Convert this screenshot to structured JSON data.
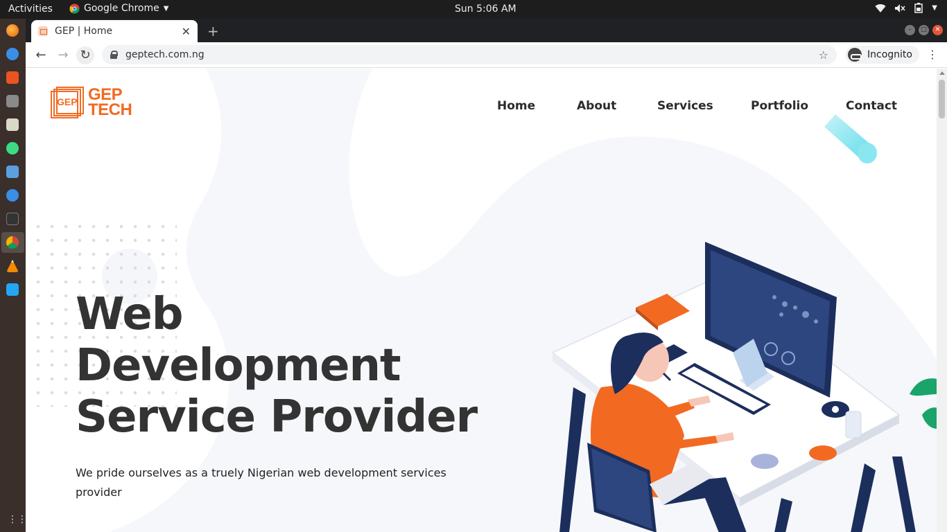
{
  "system": {
    "activities": "Activities",
    "app_name": "Google Chrome",
    "clock": "Sun  5:06 AM"
  },
  "browser": {
    "tab_title": "GEP | Home",
    "url": "geptech.com.ng",
    "incognito_label": "Incognito"
  },
  "site": {
    "logo_mark": "GEP",
    "logo_line1": "GEP",
    "logo_line2": "TECH",
    "nav": [
      "Home",
      "About",
      "Services",
      "Portfolio",
      "Contact"
    ],
    "hero_title_line1": "Web",
    "hero_title_line2": "Development",
    "hero_title_line3": "Service Provider",
    "hero_subtitle": "We pride ourselves as a truely Nigerian web development services provider"
  },
  "colors": {
    "brand": "#f26a21",
    "heading": "#333333",
    "accent_blue": "#1c2e5c"
  },
  "icons": {
    "back": "arrow-left-icon",
    "forward": "arrow-right-icon",
    "reload": "reload-icon",
    "lock": "lock-icon",
    "bookmark": "star-icon",
    "incognito": "incognito-icon",
    "menu": "kebab-menu-icon"
  }
}
